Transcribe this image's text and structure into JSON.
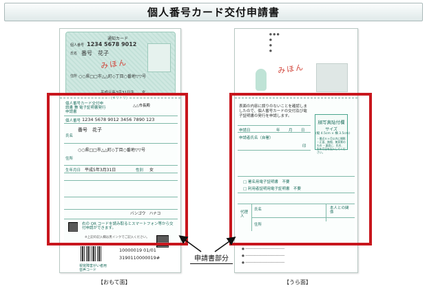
{
  "title": "個人番号カード交付申請書",
  "front": {
    "card": {
      "card_title": "通知カード",
      "number_label": "個人番号",
      "number": "1234  5678  9012",
      "name_label": "氏名",
      "name": "番号　花子",
      "address_label": "住所",
      "address": "○○県□□市△△町◇丁目○番地▽▽号",
      "dob": "平成元年3月31日生",
      "gender": "女",
      "stamp": "みほん"
    },
    "form": {
      "header": "個人番号カード交付申請書 兼 電子証明書発行申請書",
      "dest": "△△市長殿",
      "cut_label": "(キリトリ)",
      "id_label": "個人番号",
      "id_value": "1234  5678  9012  3456  7890  123",
      "name_label": "氏名",
      "name_value": "番号　花子",
      "address_label": "住所",
      "address_value": "○○県□□市△△町◇丁目○番地▽▽号",
      "dob_label": "生年月日",
      "dob_value": "平成5年3月31日",
      "gender_label": "性別",
      "gender_value": "女",
      "kana_value": "バンゴウ　ハナコ",
      "qr_note": "右の QR コードを読み取るとスマートフォン等から交付申請ができます。",
      "footer_note": "※上記の記入欄は黒インクでご記入ください。"
    },
    "bottom": {
      "vi_label": "視覚障害がい者用音声コード",
      "code1": "10000019  01/01",
      "code2": "3190110000019#"
    },
    "caption": "【おもて面】"
  },
  "back": {
    "form": {
      "intro": "表面の内容に誤りのないことを確認しましたので、個人番号カードの交付及び電子証明書の発行を申請します。",
      "date_label": "申請日",
      "year": "年",
      "month": "月",
      "day": "日",
      "sign_label": "申請者氏名（自署）",
      "seal": "印",
      "photo_title": "顔写真貼付欄",
      "photo_size_label": "サイズ",
      "photo_size": "(縦 4.5cm × 横 3.5cm)",
      "photo_notes": "・最近６ヶ月以内に撮影 ・正面、無帽、無背景のもの ・裏面に、氏名、生年月日を記入してください。",
      "cert_opt1": "署名用電子証明書　不要",
      "cert_opt2": "利用者証明用電子証明書　不要",
      "proxy_label": "代理人",
      "proxy_name": "氏名",
      "proxy_address": "住所",
      "relation_label": "本人との関係",
      "stamp": "みほん"
    },
    "caption": "【うら面】"
  },
  "callout": "申請書部分",
  "colors": {
    "highlight": "#c8161d",
    "accent_green": "#2e8c78"
  }
}
